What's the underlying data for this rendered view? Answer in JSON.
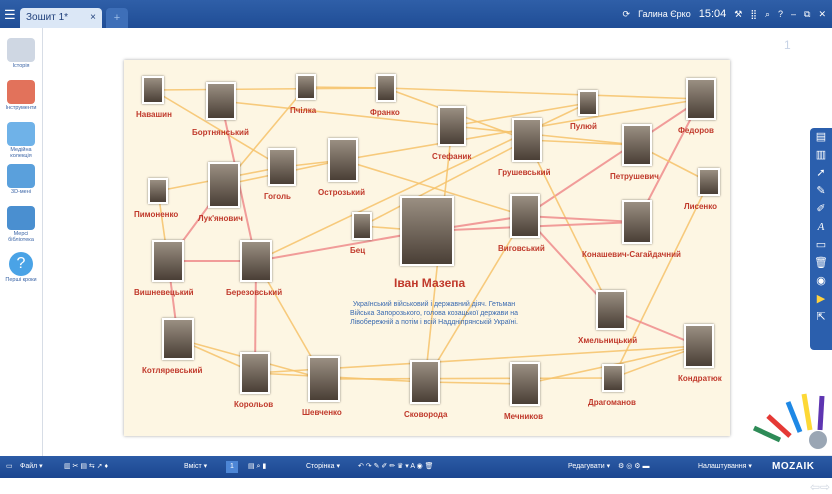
{
  "topbar": {
    "menu_icon": "hamburger-icon",
    "tab_label": "Зошит 1*",
    "tab_close": "×",
    "tab_add": "+",
    "user": "Галина Єрко",
    "time": "15:04",
    "icons": [
      "sync-icon",
      "tools-icon",
      "grid-icon",
      "search-icon",
      "help-icon",
      "minimize-icon",
      "restore-icon",
      "close-icon"
    ],
    "help": "?",
    "minimize": "–",
    "close": "✕"
  },
  "sidebar": {
    "items": [
      {
        "label": "Історія",
        "icon": "museum-icon"
      },
      {
        "label": "Інструменти",
        "icon": "tools-icon"
      },
      {
        "label": "Медійна колекція",
        "icon": "media-icon"
      },
      {
        "label": "3D-мені",
        "icon": "3d-icon"
      },
      {
        "label": "Мерсі бібліотека",
        "icon": "library-icon"
      },
      {
        "label": "Перші кроки",
        "icon": "help-icon"
      }
    ]
  },
  "page_number": "1",
  "persons": [
    {
      "id": "navashyn",
      "name": "Навашин"
    },
    {
      "id": "bortnianskyi",
      "name": "Бортнянський"
    },
    {
      "id": "pchilka",
      "name": "Пчілка"
    },
    {
      "id": "franko",
      "name": "Франко"
    },
    {
      "id": "puliui",
      "name": "Пулюй"
    },
    {
      "id": "fedorov",
      "name": "Федоров"
    },
    {
      "id": "stefanyk",
      "name": "Стефаник"
    },
    {
      "id": "hrushevskyi",
      "name": "Грушевський"
    },
    {
      "id": "petrushevych",
      "name": "Петрушевич"
    },
    {
      "id": "lysenko",
      "name": "Лисенко"
    },
    {
      "id": "pymonenko",
      "name": "Пимоненко"
    },
    {
      "id": "lukianovych",
      "name": "Лук'янович"
    },
    {
      "id": "hohol",
      "name": "Гоголь"
    },
    {
      "id": "ostrozkyi",
      "name": "Острозький"
    },
    {
      "id": "bets",
      "name": "Бец"
    },
    {
      "id": "vyhovskyi",
      "name": "Виговський"
    },
    {
      "id": "konashevych",
      "name": "Конашевич-Сагайдачний"
    },
    {
      "id": "vyshnevetskyi",
      "name": "Вишневецький"
    },
    {
      "id": "berezovskyi",
      "name": "Березовський"
    },
    {
      "id": "khmelnytskyi",
      "name": "Хмельницький"
    },
    {
      "id": "kotliarevskyi",
      "name": "Котляревський"
    },
    {
      "id": "kondratiuk",
      "name": "Кондратюк"
    },
    {
      "id": "koroliov",
      "name": "Корольов"
    },
    {
      "id": "shevchenko",
      "name": "Шевченко"
    },
    {
      "id": "skovoroda",
      "name": "Сковорода"
    },
    {
      "id": "mechnykov",
      "name": "Мечников"
    },
    {
      "id": "drahomanov",
      "name": "Драгоманов"
    }
  ],
  "center": {
    "name": "Іван Мазепа",
    "caption": "Український військовий і державний діяч. Гетьман Війська Запорозького, голова козацької держави на Лівобережній а потім і всій Наддніпрянській Україні."
  },
  "right_toolbar_icons": [
    "document-icon",
    "page-icon",
    "pointer-icon",
    "pen-icon",
    "marker-icon",
    "text-icon",
    "eraser-icon",
    "trash-icon",
    "record-icon",
    "play-icon",
    "share-icon"
  ],
  "bottombar": {
    "file": "Файл ▾",
    "insert": "Вміст ▾",
    "page": "1",
    "pages": "Сторінка ▾",
    "edit": "Редагувати ▾",
    "settings": "Налаштування ▾",
    "logo": "MOZAIK"
  },
  "colors": {
    "topbar": "#2459a5",
    "name_red": "#c0392b",
    "caption_blue": "#3a6ab0",
    "line_orange": "#f6c36b",
    "line_pink": "#ef8d8d"
  }
}
